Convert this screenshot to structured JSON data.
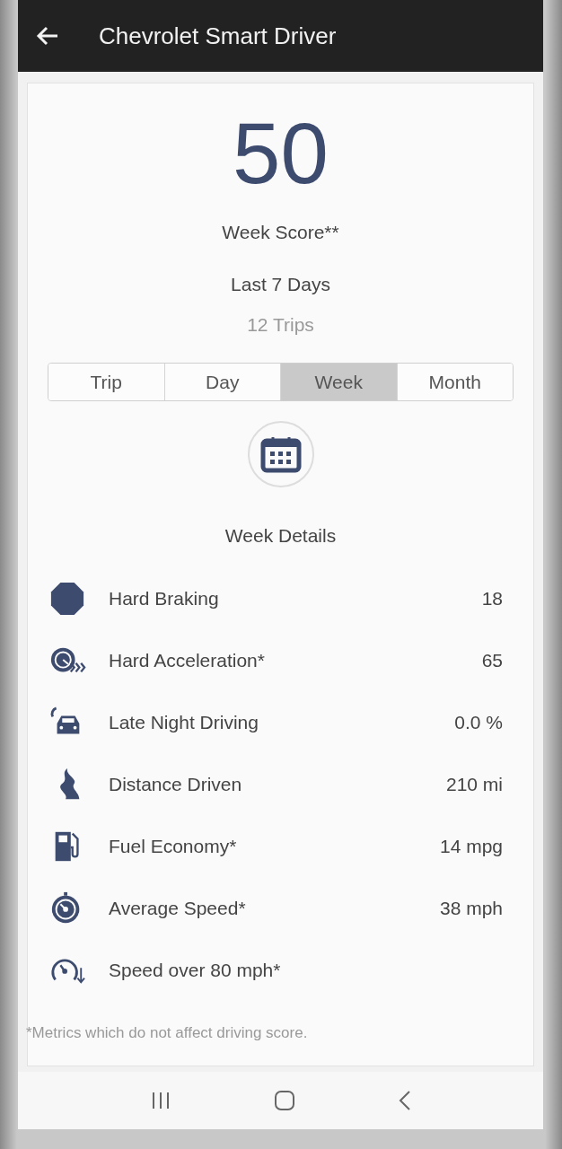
{
  "app_bar": {
    "title": "Chevrolet Smart Driver"
  },
  "score": {
    "value": "50",
    "label": "Week Score**",
    "period": "Last 7 Days",
    "trips": "12 Trips"
  },
  "tabs": [
    {
      "label": "Trip",
      "selected": false
    },
    {
      "label": "Day",
      "selected": false
    },
    {
      "label": "Week",
      "selected": true
    },
    {
      "label": "Month",
      "selected": false
    }
  ],
  "details_title": "Week Details",
  "metrics": [
    {
      "kind": "braking",
      "label": "Hard Braking",
      "value": "18"
    },
    {
      "kind": "acceleration",
      "label": "Hard Acceleration*",
      "value": "65"
    },
    {
      "kind": "night",
      "label": "Late Night Driving",
      "value": "0.0 %"
    },
    {
      "kind": "distance",
      "label": "Distance Driven",
      "value": "210 mi"
    },
    {
      "kind": "fuel",
      "label": "Fuel Economy*",
      "value": "14 mpg"
    },
    {
      "kind": "speed",
      "label": "Average Speed*",
      "value": "38 mph"
    },
    {
      "kind": "overspeed",
      "label": "Speed over 80 mph*"
    }
  ],
  "footnote": "*Metrics which do not affect driving score."
}
